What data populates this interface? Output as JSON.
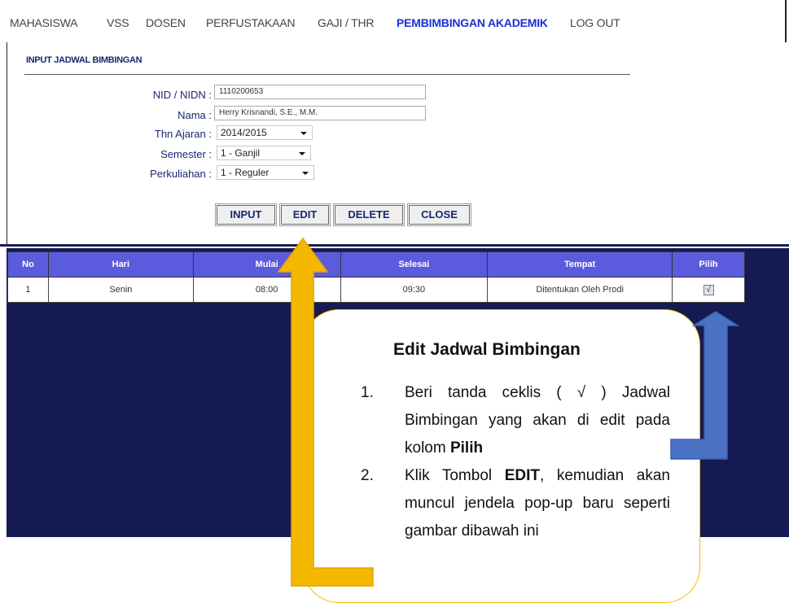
{
  "nav": {
    "items": [
      {
        "label": "MAHASISWA"
      },
      {
        "label": "VSS"
      },
      {
        "label": "DOSEN"
      },
      {
        "label": "PERFUSTAKAAN"
      },
      {
        "label": "GAJI / THR"
      },
      {
        "label": "PEMBIMBINGAN AKADEMIK"
      },
      {
        "label": "LOG OUT"
      }
    ],
    "active": "PEMBIMBINGAN AKADEMIK"
  },
  "form": {
    "title": "INPUT JADWAL BIMBINGAN",
    "nid_label": "NID / NIDN :",
    "nid_value": "1110200653",
    "nama_label": "Nama :",
    "nama_value": "Herry Krisnandi, S.E., M.M.",
    "thn_label": "Thn Ajaran :",
    "thn_value": "2014/2015",
    "semester_label": "Semester :",
    "semester_value": "1 - Ganjil",
    "perkuliahan_label": "Perkuliahan :",
    "perkuliahan_value": "1 - Reguler"
  },
  "buttons": {
    "input": "INPUT",
    "edit": "EDIT",
    "delete": "DELETE",
    "close": "CLOSE"
  },
  "table": {
    "headers": [
      "No",
      "Hari",
      "Mulai",
      "Selesai",
      "Tempat",
      "Pilih"
    ],
    "rows": [
      {
        "no": "1",
        "hari": "Senin",
        "mulai": "08:00",
        "selesai": "09:30",
        "tempat": "Ditentukan Oleh Prodi",
        "pilih": "√"
      }
    ]
  },
  "callout": {
    "title": "Edit Jadwal Bimbingan",
    "step1_num": "1.",
    "step1_text": "Beri tanda ceklis ( √ ) Jadwal Bimbingan yang akan di edit pada kolom ",
    "step1_bold": "Pilih",
    "step2_num": "2.",
    "step2_pre": "Klik Tombol ",
    "step2_bold": "EDIT",
    "step2_post": ", kemudian akan muncul jendela pop-up baru seperti gambar dibawah ini"
  },
  "colors": {
    "nav_active": "#1a2fd6",
    "table_header": "#5b5bde",
    "background_navy": "#161a52",
    "arrow_yellow": "#f5b800",
    "arrow_blue": "#4a72c4",
    "callout_border": "#f2c200"
  }
}
